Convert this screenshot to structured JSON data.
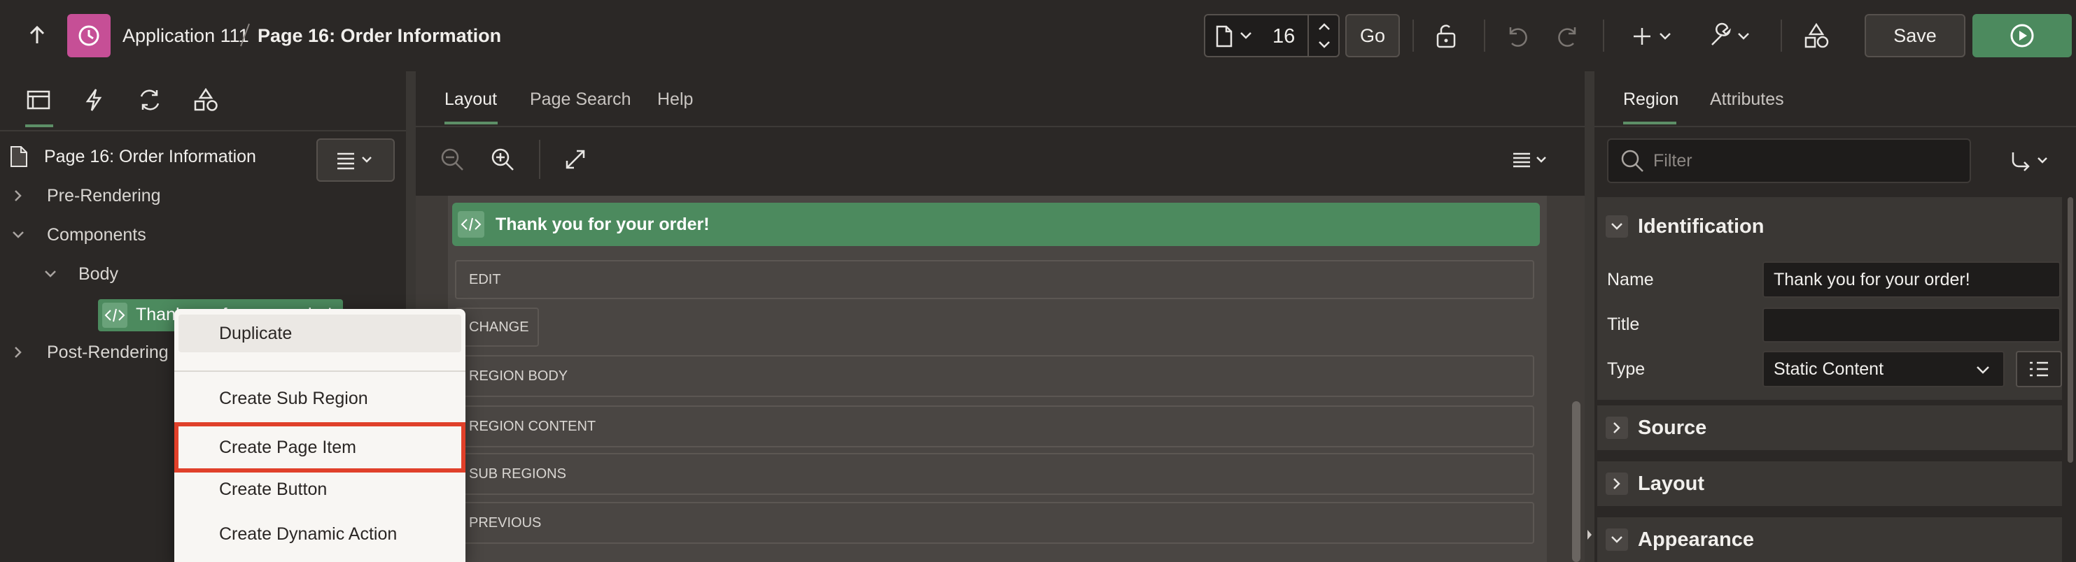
{
  "header": {
    "app_name": "Application 111",
    "page_title": "Page 16: Order Information",
    "page_number": "16",
    "go_label": "Go",
    "save_label": "Save"
  },
  "left": {
    "tree_root": "Page 16: Order Information",
    "nodes": {
      "pre_rendering": "Pre-Rendering",
      "components": "Components",
      "body": "Body",
      "region": "Thank you for your order!",
      "post_rendering": "Post-Rendering"
    }
  },
  "context_menu": {
    "items": [
      "Duplicate",
      "Create Sub Region",
      "Create Page Item",
      "Create Button",
      "Create Dynamic Action"
    ],
    "highlighted": "Create Page Item",
    "highlight_color": "#e0402a"
  },
  "center": {
    "tabs": [
      "Layout",
      "Page Search",
      "Help"
    ],
    "active_tab": "Layout",
    "region_title": "Thank you for your order!",
    "positions": [
      "EDIT",
      "CHANGE",
      "REGION BODY",
      "REGION CONTENT",
      "SUB REGIONS",
      "PREVIOUS"
    ]
  },
  "right": {
    "tabs": [
      "Region",
      "Attributes"
    ],
    "active_tab": "Region",
    "filter_placeholder": "Filter",
    "sections": {
      "identification": "Identification",
      "source": "Source",
      "layout": "Layout",
      "appearance": "Appearance"
    },
    "fields": {
      "name_label": "Name",
      "name_value": "Thank you for your order!",
      "title_label": "Title",
      "title_value": "",
      "type_label": "Type",
      "type_value": "Static Content"
    }
  },
  "colors": {
    "accent_green": "#4c8a5e",
    "app_icon": "#c64f96",
    "tab_underline": "#5d8f67"
  }
}
